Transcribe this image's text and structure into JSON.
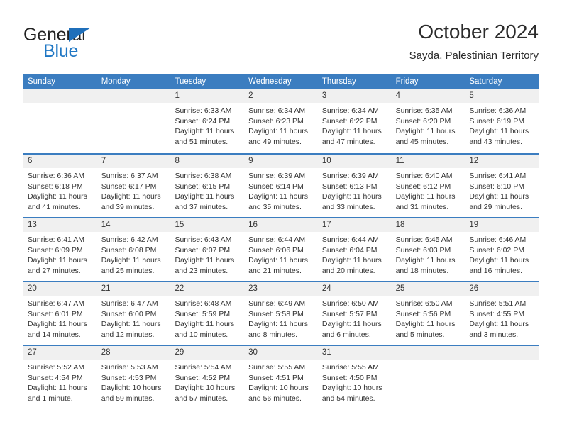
{
  "brand": {
    "name_part1": "General",
    "name_part2": "Blue",
    "triangle_color": "#1f6fba",
    "blue_color": "#1f77c4"
  },
  "header": {
    "title": "October 2024",
    "subtitle": "Sayda, Palestinian Territory"
  },
  "theme": {
    "header_blue": "#3b7dc0",
    "daynum_band": "#f0f0f0",
    "text": "#333333"
  },
  "weekdays": [
    "Sunday",
    "Monday",
    "Tuesday",
    "Wednesday",
    "Thursday",
    "Friday",
    "Saturday"
  ],
  "weeks": [
    {
      "days": [
        {
          "num": "",
          "lines": []
        },
        {
          "num": "",
          "lines": []
        },
        {
          "num": "1",
          "lines": [
            "Sunrise: 6:33 AM",
            "Sunset: 6:24 PM",
            "Daylight: 11 hours",
            "and 51 minutes."
          ]
        },
        {
          "num": "2",
          "lines": [
            "Sunrise: 6:34 AM",
            "Sunset: 6:23 PM",
            "Daylight: 11 hours",
            "and 49 minutes."
          ]
        },
        {
          "num": "3",
          "lines": [
            "Sunrise: 6:34 AM",
            "Sunset: 6:22 PM",
            "Daylight: 11 hours",
            "and 47 minutes."
          ]
        },
        {
          "num": "4",
          "lines": [
            "Sunrise: 6:35 AM",
            "Sunset: 6:20 PM",
            "Daylight: 11 hours",
            "and 45 minutes."
          ]
        },
        {
          "num": "5",
          "lines": [
            "Sunrise: 6:36 AM",
            "Sunset: 6:19 PM",
            "Daylight: 11 hours",
            "and 43 minutes."
          ]
        }
      ]
    },
    {
      "days": [
        {
          "num": "6",
          "lines": [
            "Sunrise: 6:36 AM",
            "Sunset: 6:18 PM",
            "Daylight: 11 hours",
            "and 41 minutes."
          ]
        },
        {
          "num": "7",
          "lines": [
            "Sunrise: 6:37 AM",
            "Sunset: 6:17 PM",
            "Daylight: 11 hours",
            "and 39 minutes."
          ]
        },
        {
          "num": "8",
          "lines": [
            "Sunrise: 6:38 AM",
            "Sunset: 6:15 PM",
            "Daylight: 11 hours",
            "and 37 minutes."
          ]
        },
        {
          "num": "9",
          "lines": [
            "Sunrise: 6:39 AM",
            "Sunset: 6:14 PM",
            "Daylight: 11 hours",
            "and 35 minutes."
          ]
        },
        {
          "num": "10",
          "lines": [
            "Sunrise: 6:39 AM",
            "Sunset: 6:13 PM",
            "Daylight: 11 hours",
            "and 33 minutes."
          ]
        },
        {
          "num": "11",
          "lines": [
            "Sunrise: 6:40 AM",
            "Sunset: 6:12 PM",
            "Daylight: 11 hours",
            "and 31 minutes."
          ]
        },
        {
          "num": "12",
          "lines": [
            "Sunrise: 6:41 AM",
            "Sunset: 6:10 PM",
            "Daylight: 11 hours",
            "and 29 minutes."
          ]
        }
      ]
    },
    {
      "days": [
        {
          "num": "13",
          "lines": [
            "Sunrise: 6:41 AM",
            "Sunset: 6:09 PM",
            "Daylight: 11 hours",
            "and 27 minutes."
          ]
        },
        {
          "num": "14",
          "lines": [
            "Sunrise: 6:42 AM",
            "Sunset: 6:08 PM",
            "Daylight: 11 hours",
            "and 25 minutes."
          ]
        },
        {
          "num": "15",
          "lines": [
            "Sunrise: 6:43 AM",
            "Sunset: 6:07 PM",
            "Daylight: 11 hours",
            "and 23 minutes."
          ]
        },
        {
          "num": "16",
          "lines": [
            "Sunrise: 6:44 AM",
            "Sunset: 6:06 PM",
            "Daylight: 11 hours",
            "and 21 minutes."
          ]
        },
        {
          "num": "17",
          "lines": [
            "Sunrise: 6:44 AM",
            "Sunset: 6:04 PM",
            "Daylight: 11 hours",
            "and 20 minutes."
          ]
        },
        {
          "num": "18",
          "lines": [
            "Sunrise: 6:45 AM",
            "Sunset: 6:03 PM",
            "Daylight: 11 hours",
            "and 18 minutes."
          ]
        },
        {
          "num": "19",
          "lines": [
            "Sunrise: 6:46 AM",
            "Sunset: 6:02 PM",
            "Daylight: 11 hours",
            "and 16 minutes."
          ]
        }
      ]
    },
    {
      "days": [
        {
          "num": "20",
          "lines": [
            "Sunrise: 6:47 AM",
            "Sunset: 6:01 PM",
            "Daylight: 11 hours",
            "and 14 minutes."
          ]
        },
        {
          "num": "21",
          "lines": [
            "Sunrise: 6:47 AM",
            "Sunset: 6:00 PM",
            "Daylight: 11 hours",
            "and 12 minutes."
          ]
        },
        {
          "num": "22",
          "lines": [
            "Sunrise: 6:48 AM",
            "Sunset: 5:59 PM",
            "Daylight: 11 hours",
            "and 10 minutes."
          ]
        },
        {
          "num": "23",
          "lines": [
            "Sunrise: 6:49 AM",
            "Sunset: 5:58 PM",
            "Daylight: 11 hours",
            "and 8 minutes."
          ]
        },
        {
          "num": "24",
          "lines": [
            "Sunrise: 6:50 AM",
            "Sunset: 5:57 PM",
            "Daylight: 11 hours",
            "and 6 minutes."
          ]
        },
        {
          "num": "25",
          "lines": [
            "Sunrise: 6:50 AM",
            "Sunset: 5:56 PM",
            "Daylight: 11 hours",
            "and 5 minutes."
          ]
        },
        {
          "num": "26",
          "lines": [
            "Sunrise: 5:51 AM",
            "Sunset: 4:55 PM",
            "Daylight: 11 hours",
            "and 3 minutes."
          ]
        }
      ]
    },
    {
      "days": [
        {
          "num": "27",
          "lines": [
            "Sunrise: 5:52 AM",
            "Sunset: 4:54 PM",
            "Daylight: 11 hours",
            "and 1 minute."
          ]
        },
        {
          "num": "28",
          "lines": [
            "Sunrise: 5:53 AM",
            "Sunset: 4:53 PM",
            "Daylight: 10 hours",
            "and 59 minutes."
          ]
        },
        {
          "num": "29",
          "lines": [
            "Sunrise: 5:54 AM",
            "Sunset: 4:52 PM",
            "Daylight: 10 hours",
            "and 57 minutes."
          ]
        },
        {
          "num": "30",
          "lines": [
            "Sunrise: 5:55 AM",
            "Sunset: 4:51 PM",
            "Daylight: 10 hours",
            "and 56 minutes."
          ]
        },
        {
          "num": "31",
          "lines": [
            "Sunrise: 5:55 AM",
            "Sunset: 4:50 PM",
            "Daylight: 10 hours",
            "and 54 minutes."
          ]
        },
        {
          "num": "",
          "lines": []
        },
        {
          "num": "",
          "lines": []
        }
      ]
    }
  ]
}
